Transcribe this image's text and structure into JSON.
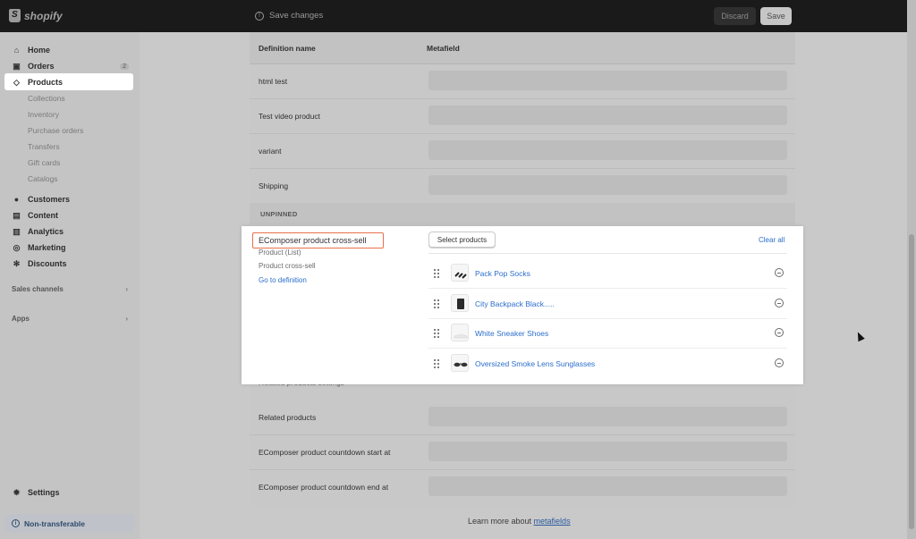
{
  "topbar": {
    "logo_text": "shopify",
    "save_changes": "Save changes",
    "discard_label": "Discard",
    "save_label": "Save"
  },
  "sidebar": {
    "home": "Home",
    "orders": "Orders",
    "orders_badge": "2",
    "products": "Products",
    "sub_items": [
      "Collections",
      "Inventory",
      "Purchase orders",
      "Transfers",
      "Gift cards",
      "Catalogs"
    ],
    "customers": "Customers",
    "content": "Content",
    "analytics": "Analytics",
    "marketing": "Marketing",
    "discounts": "Discounts",
    "sales_channels": "Sales channels",
    "apps": "Apps",
    "settings": "Settings",
    "non_transferable": "Non-transferable"
  },
  "table": {
    "col_definition": "Definition name",
    "col_metafield": "Metafield",
    "pinned_rows": [
      "html test",
      "Test video product",
      "variant",
      "Shipping"
    ],
    "unpinned_label": "UNPINNED",
    "behind_text": "Related products settings",
    "bottom_rows": [
      "Related products",
      "EComposer product countdown start at",
      "EComposer product countdown end at"
    ]
  },
  "panel": {
    "definition_title": "EComposer product cross-sell",
    "definition_type": "Product (List)",
    "definition_desc": "Product cross-sell",
    "go_to_definition": "Go to definition",
    "select_products": "Select products",
    "clear_all": "Clear all",
    "products": [
      {
        "name": "Pack Pop Socks"
      },
      {
        "name": "City Backpack Black....."
      },
      {
        "name": "White Sneaker Shoes"
      },
      {
        "name": "Oversized Smoke Lens Sunglasses"
      }
    ]
  },
  "footer": {
    "learn_more": "Learn more about ",
    "metafields_link": "metafields"
  }
}
